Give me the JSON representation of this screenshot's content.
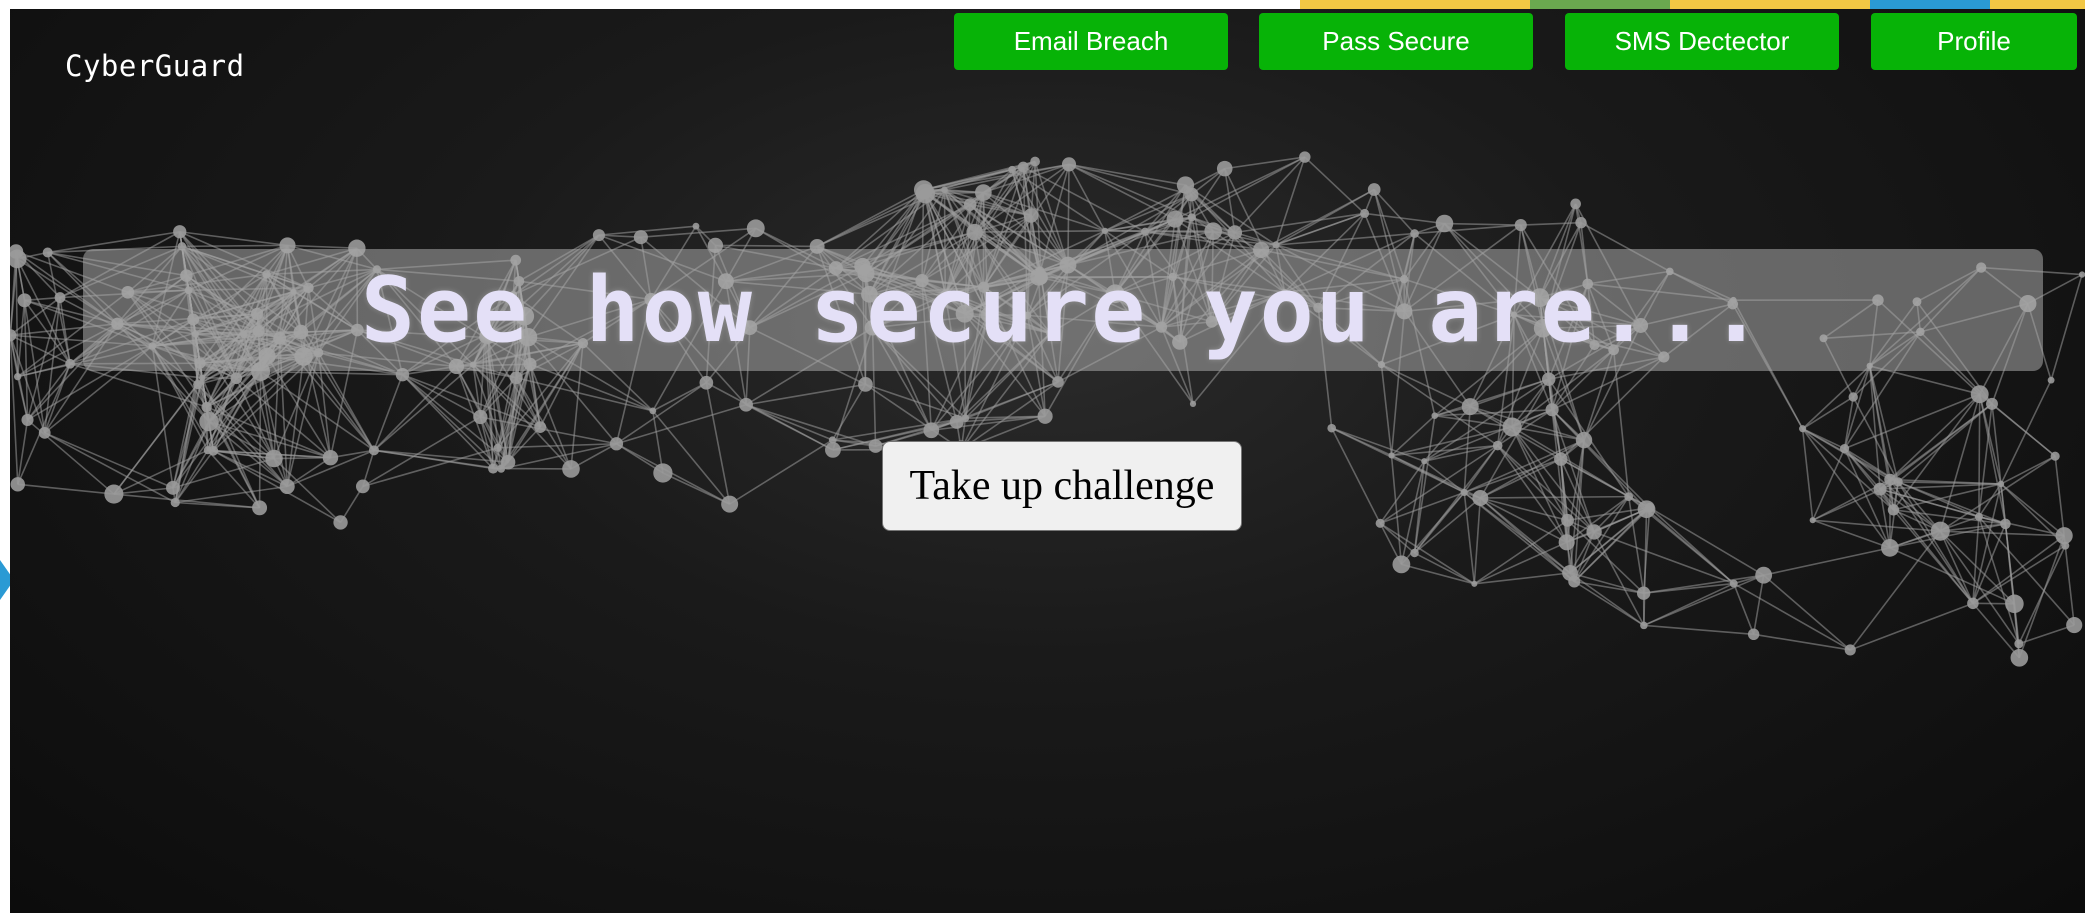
{
  "brand": {
    "name": "CyberGuard"
  },
  "nav": {
    "items": [
      {
        "label": "Email Breach"
      },
      {
        "label": "Pass Secure"
      },
      {
        "label": "SMS Dectector"
      },
      {
        "label": "Profile"
      }
    ]
  },
  "hero": {
    "headline": "See how secure you are...",
    "cta_label": "Take up challenge"
  },
  "colors": {
    "nav_button": "#07b307",
    "headline_text": "#e4e0f7",
    "background": "#111111",
    "network": "#9a9a9a"
  },
  "background_art": {
    "name": "network-graph"
  }
}
